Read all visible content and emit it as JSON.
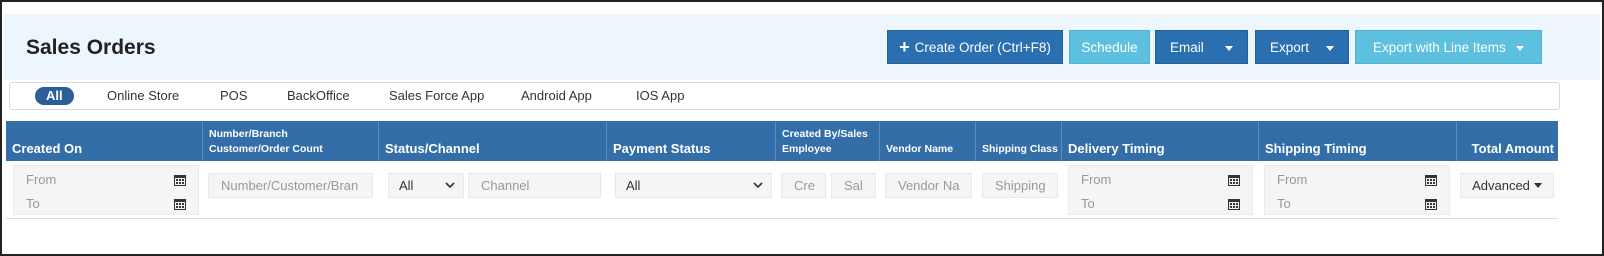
{
  "page": {
    "title": "Sales Orders"
  },
  "toolbar": {
    "create_order": "Create Order (Ctrl+F8)",
    "schedule": "Schedule",
    "email": "Email",
    "export": "Export",
    "export_line_items": "Export with Line Items"
  },
  "tabs": [
    "All",
    "Online Store",
    "POS",
    "BackOffice",
    "Sales Force App",
    "Android App",
    "IOS App"
  ],
  "columns": {
    "created_on": "Created On",
    "number_line1": "Number/Branch",
    "number_line2": "Customer/Order Count",
    "status_channel": "Status/Channel",
    "payment_status": "Payment Status",
    "created_by_line1": "Created By/Sales",
    "created_by_line2": "Employee",
    "vendor_name": "Vendor Name",
    "shipping_class": "Shipping Class",
    "delivery_timing": "Delivery Timing",
    "shipping_timing": "Shipping Timing",
    "total_amount": "Total Amount"
  },
  "filters": {
    "from": "From",
    "to": "To",
    "number_placeholder": "Number/Customer/Bran",
    "status_value": "All",
    "channel_placeholder": "Channel",
    "payment_value": "All",
    "created_by_placeholder": "Cre",
    "sales_placeholder": "Sal",
    "vendor_placeholder": "Vendor Na",
    "shipping_placeholder": "Shipping",
    "advanced": "Advanced"
  },
  "colors": {
    "primary": "#2a6fb0",
    "info": "#5cc0de",
    "header_bg": "#336ea9",
    "tab_active": "#2b5f9a",
    "page_header_bg": "#eef6fd"
  },
  "icons": [
    "plus-icon",
    "caret-down-icon",
    "calendar-icon",
    "chevron-down-icon"
  ]
}
